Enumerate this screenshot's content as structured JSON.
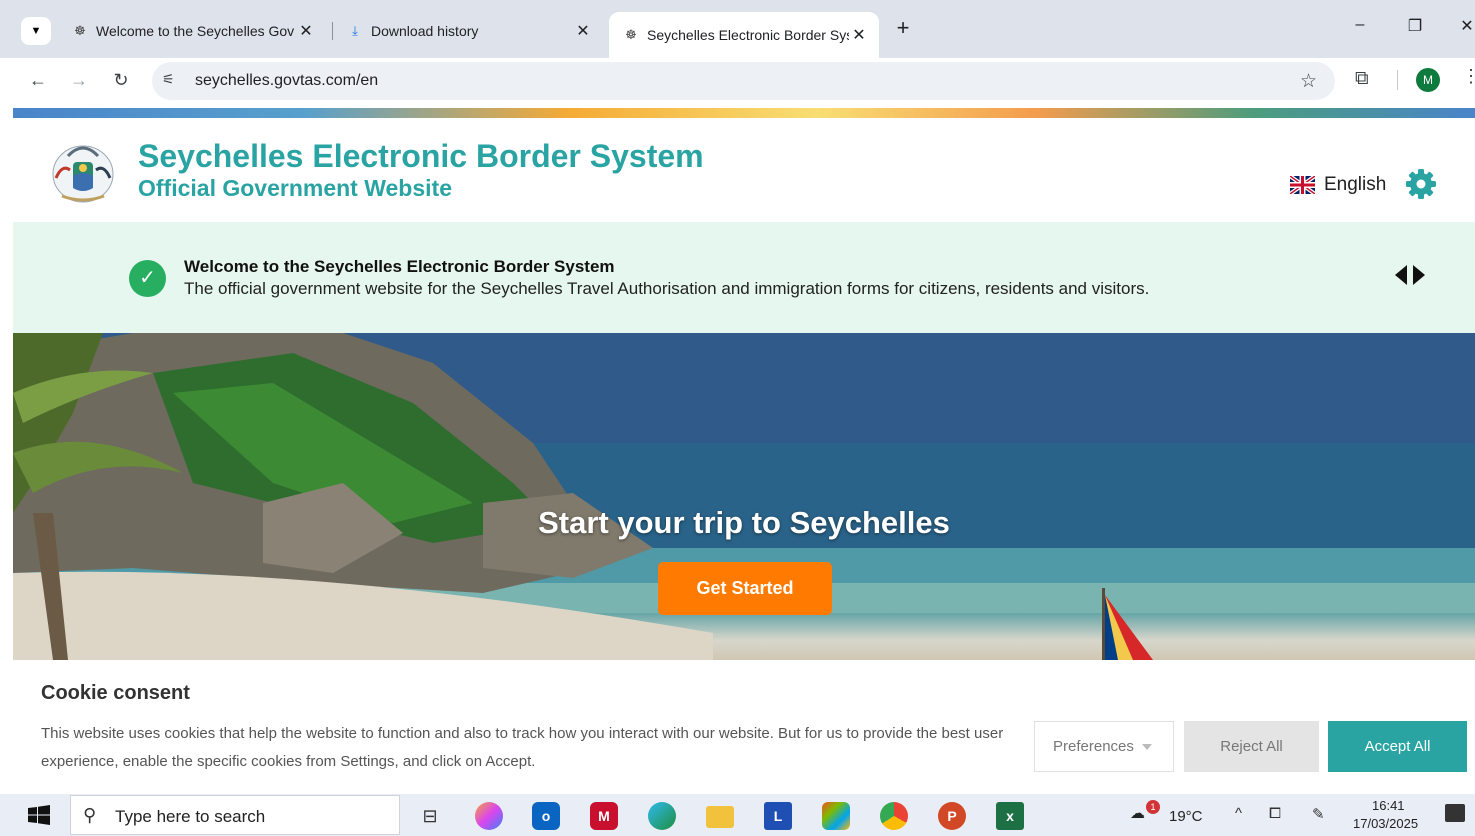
{
  "browser": {
    "tabs": [
      {
        "title": "Welcome to the Seychelles Gov",
        "icon": "seychelles-crest-icon",
        "active": false
      },
      {
        "title": "Download history",
        "icon": "download-icon",
        "active": false
      },
      {
        "title": "Seychelles Electronic Border Sys",
        "icon": "seychelles-crest-icon",
        "active": true
      }
    ],
    "tab_close_glyph": "✕",
    "new_tab_glyph": "+",
    "url": "seychelles.govtas.com/en",
    "profile_initial": "M",
    "window_controls": {
      "minimize": "–",
      "restore": "❐",
      "close": "✕"
    }
  },
  "site": {
    "title": "Seychelles Electronic Border System",
    "subtitle": "Official Government Website",
    "language": "English",
    "accent_color": "#2aa3a3"
  },
  "banner": {
    "title": "Welcome to the Seychelles Electronic Border System",
    "text": "The official government website for the Seychelles Travel Authorisation and immigration forms for citizens, residents and visitors."
  },
  "hero": {
    "title": "Start your trip to Seychelles",
    "cta_label": "Get Started",
    "cta_color": "#ff7a00"
  },
  "cookie": {
    "title": "Cookie consent",
    "text": "This website uses cookies that help the website to function and also to track how you interact with our website. But for us to provide the best user experience, enable the specific cookies from Settings, and click on Accept.",
    "preferences_label": "Preferences",
    "reject_label": "Reject All",
    "accept_label": "Accept All"
  },
  "taskbar": {
    "search_placeholder": "Type here to search",
    "apps": [
      "task-view-icon",
      "copilot-icon",
      "outlook-icon",
      "mcafee-icon",
      "edge-icon",
      "file-explorer-icon",
      "l-app-icon",
      "m365-icon",
      "chrome-icon",
      "powerpoint-icon",
      "excel-icon"
    ],
    "weather_badge": "1",
    "temperature": "19°C",
    "time": "16:41",
    "date": "17/03/2025"
  }
}
